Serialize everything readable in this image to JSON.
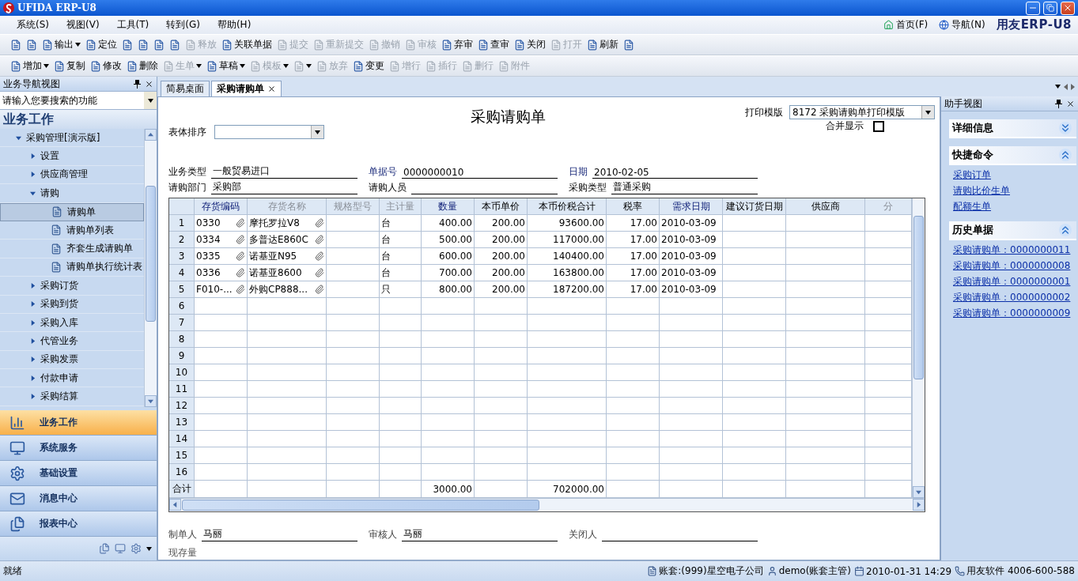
{
  "window": {
    "title": "UFIDA ERP-U8"
  },
  "menu": [
    {
      "label": "系统(S)"
    },
    {
      "label": "视图(V)"
    },
    {
      "label": "工具(T)"
    },
    {
      "label": "转到(G)"
    },
    {
      "label": "帮助(H)"
    }
  ],
  "quick_links": [
    {
      "label": "首页(F)"
    },
    {
      "label": "导航(N)"
    }
  ],
  "logo": {
    "text": "用友ERP-U8"
  },
  "toolbars": [
    {
      "items": [
        {
          "disabled": false
        },
        {
          "disabled": false
        },
        {
          "label": "输出",
          "disabled": false,
          "dropdown": true
        },
        {
          "label": "定位",
          "disabled": false
        },
        {
          "disabled": false
        },
        {
          "disabled": false
        },
        {
          "disabled": false
        },
        {
          "disabled": false
        },
        {
          "label": "释放",
          "disabled": true
        },
        {
          "label": "关联单据",
          "disabled": false
        },
        {
          "label": "提交",
          "disabled": true
        },
        {
          "label": "重新提交",
          "disabled": true
        },
        {
          "label": "撤销",
          "disabled": true
        },
        {
          "label": "审核",
          "disabled": true
        },
        {
          "label": "弃审",
          "disabled": false
        },
        {
          "label": "查审",
          "disabled": false
        },
        {
          "label": "关闭",
          "disabled": false
        },
        {
          "label": "打开",
          "disabled": true
        },
        {
          "label": "刷新",
          "disabled": false
        },
        {
          "disabled": false
        }
      ]
    },
    {
      "items": [
        {
          "label": "增加",
          "disabled": false,
          "dropdown": true
        },
        {
          "label": "复制",
          "disabled": false
        },
        {
          "label": "修改",
          "disabled": false
        },
        {
          "label": "删除",
          "disabled": false
        },
        {
          "label": "生单",
          "disabled": true,
          "dropdown": true
        },
        {
          "label": "草稿",
          "disabled": false,
          "dropdown": true
        },
        {
          "label": "模板",
          "disabled": true,
          "dropdown": true
        },
        {
          "disabled": true,
          "dropdown": true
        },
        {
          "label": "放弃",
          "disabled": true
        },
        {
          "label": "变更",
          "disabled": false
        },
        {
          "label": "增行",
          "disabled": true
        },
        {
          "label": "插行",
          "disabled": true
        },
        {
          "label": "删行",
          "disabled": true
        },
        {
          "label": "附件",
          "disabled": true
        }
      ]
    }
  ],
  "nav_panel": {
    "title": "业务导航视图",
    "search": {
      "placeholder": "请输入您要搜索的功能"
    },
    "heading": "业务工作",
    "tree": [
      {
        "label": "采购管理[演示版]",
        "kind": "folder",
        "expanded": true,
        "selected": false,
        "children": [
          {
            "label": "设置",
            "kind": "folder",
            "expanded": false,
            "selected": false
          },
          {
            "label": "供应商管理",
            "kind": "folder",
            "expanded": false,
            "selected": false
          },
          {
            "label": "请购",
            "kind": "folder",
            "expanded": true,
            "selected": false,
            "children": [
              {
                "label": "请购单",
                "kind": "document",
                "selected": true
              },
              {
                "label": "请购单列表",
                "kind": "document",
                "selected": false
              },
              {
                "label": "齐套生成请购单",
                "kind": "document",
                "selected": false
              },
              {
                "label": "请购单执行统计表",
                "kind": "document",
                "selected": false
              }
            ]
          },
          {
            "label": "采购订货",
            "kind": "folder",
            "expanded": false,
            "selected": false
          },
          {
            "label": "采购到货",
            "kind": "folder",
            "expanded": false,
            "selected": false
          },
          {
            "label": "采购入库",
            "kind": "folder",
            "expanded": false,
            "selected": false
          },
          {
            "label": "代管业务",
            "kind": "folder",
            "expanded": false,
            "selected": false
          },
          {
            "label": "采购发票",
            "kind": "folder",
            "expanded": false,
            "selected": false
          },
          {
            "label": "付款申请",
            "kind": "folder",
            "expanded": false,
            "selected": false
          },
          {
            "label": "采购结算",
            "kind": "folder",
            "expanded": false,
            "selected": false
          }
        ]
      }
    ],
    "modules": [
      {
        "label": "业务工作",
        "selected": true
      },
      {
        "label": "系统服务",
        "selected": false
      },
      {
        "label": "基础设置",
        "selected": false
      },
      {
        "label": "消息中心",
        "selected": false
      },
      {
        "label": "报表中心",
        "selected": false
      }
    ]
  },
  "tabs": [
    {
      "label": "简易桌面",
      "selected": false,
      "closable": false
    },
    {
      "label": "采购请购单",
      "selected": true,
      "closable": true
    }
  ],
  "document": {
    "title": "采购请购单",
    "print_template": {
      "label": "打印模版",
      "value": "8172 采购请购单打印模版"
    },
    "sort": {
      "label": "表体排序"
    },
    "merge_display": {
      "label": "合并显示",
      "checked": false
    },
    "header_fields": [
      [
        {
          "label": "业务类型",
          "value": "一般贸易进口",
          "required": false
        },
        {
          "label": "单据号",
          "value": "0000000010",
          "required": true
        },
        {
          "label": "日期",
          "value": "2010-02-05",
          "required": true
        }
      ],
      [
        {
          "label": "请购部门",
          "value": "采购部",
          "required": false
        },
        {
          "label": "请购人员",
          "required": false
        },
        {
          "label": "采购类型",
          "value": "普通采购",
          "required": false
        }
      ]
    ],
    "table": {
      "columns": [
        {
          "label": "存货编码",
          "kind": "lookup",
          "required": true,
          "locked": false
        },
        {
          "label": "存货名称",
          "kind": "lookup",
          "required": false,
          "locked": true
        },
        {
          "label": "规格型号",
          "kind": "text",
          "required": false,
          "locked": true
        },
        {
          "label": "主计量",
          "kind": "text",
          "required": false,
          "locked": true
        },
        {
          "label": "数量",
          "kind": "number",
          "required": true,
          "locked": false
        },
        {
          "label": "本币单价",
          "kind": "number",
          "required": false,
          "locked": false
        },
        {
          "label": "本币价税合计",
          "kind": "number",
          "required": false,
          "locked": false
        },
        {
          "label": "税率",
          "kind": "number",
          "required": false,
          "locked": false
        },
        {
          "label": "需求日期",
          "kind": "text",
          "required": true,
          "locked": false
        },
        {
          "label": "建议订货日期",
          "kind": "text",
          "required": false,
          "locked": false
        },
        {
          "label": "供应商",
          "kind": "text",
          "required": false,
          "locked": false
        },
        {
          "label": "分",
          "kind": "text",
          "required": false,
          "locked": true
        }
      ],
      "rows": [
        {
          "number": "1",
          "cells": [
            "0330",
            "摩托罗拉V8",
            null,
            "台",
            "400.00",
            "200.00",
            "93600.00",
            "17.00",
            "2010-03-09",
            null,
            null,
            null
          ]
        },
        {
          "number": "2",
          "cells": [
            "0334",
            "多普达E860C",
            null,
            "台",
            "500.00",
            "200.00",
            "117000.00",
            "17.00",
            "2010-03-09",
            null,
            null,
            null
          ]
        },
        {
          "number": "3",
          "cells": [
            "0335",
            "诺基亚N95",
            null,
            "台",
            "600.00",
            "200.00",
            "140400.00",
            "17.00",
            "2010-03-09",
            null,
            null,
            null
          ]
        },
        {
          "number": "4",
          "cells": [
            "0336",
            "诺基亚8600",
            null,
            "台",
            "700.00",
            "200.00",
            "163800.00",
            "17.00",
            "2010-03-09",
            null,
            null,
            null
          ]
        },
        {
          "number": "5",
          "cells": [
            "F010-...",
            "外购CP888...",
            null,
            "只",
            "800.00",
            "200.00",
            "187200.00",
            "17.00",
            "2010-03-09",
            null,
            null,
            null
          ]
        },
        {
          "number": "6"
        },
        {
          "number": "7"
        },
        {
          "number": "8"
        },
        {
          "number": "9"
        },
        {
          "number": "10"
        },
        {
          "number": "11"
        },
        {
          "number": "12"
        },
        {
          "number": "13"
        },
        {
          "number": "14"
        },
        {
          "number": "15"
        },
        {
          "number": "16"
        }
      ],
      "total": {
        "label": "合计",
        "cells": [
          null,
          null,
          null,
          null,
          "3000.00",
          null,
          "702000.00",
          null,
          null,
          null,
          null,
          null
        ]
      }
    },
    "footer_fields": [
      {
        "label": "制单人",
        "value": "马丽"
      },
      {
        "label": "审核人",
        "value": "马丽"
      },
      {
        "label": "关闭人"
      }
    ],
    "stock_label": "现存量"
  },
  "assistant": {
    "title": "助手视图",
    "sections": [
      {
        "title": "详细信息",
        "expanded": false
      },
      {
        "title": "快捷命令",
        "expanded": true,
        "links": [
          "采购订单",
          "请购比价生单",
          "配额生单"
        ]
      },
      {
        "title": "历史单据",
        "expanded": true,
        "links": [
          "采购请购单：0000000011",
          "采购请购单：0000000008",
          "采购请购单：0000000001",
          "采购请购单：0000000002",
          "采购请购单：0000000009"
        ]
      }
    ]
  },
  "status_bar": {
    "message": "就绪",
    "items": [
      {
        "text": "账套:(999)星空电子公司"
      },
      {
        "text": "demo(账套主管)"
      },
      {
        "text": "2010-01-31 14:29"
      },
      {
        "text": "用友软件 4006-600-588"
      }
    ]
  }
}
